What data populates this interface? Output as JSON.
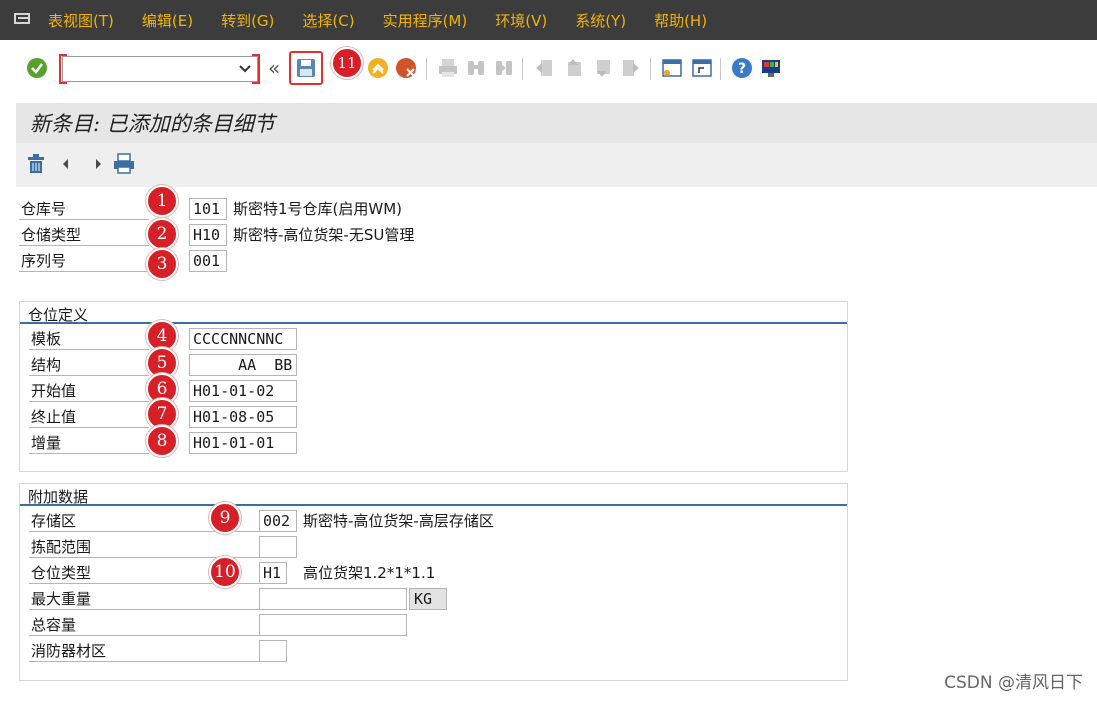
{
  "menubar": {
    "items": [
      "表视图(T)",
      "编辑(E)",
      "转到(G)",
      "选择(C)",
      "实用程序(M)",
      "环境(V)",
      "系统(Y)",
      "帮助(H)"
    ]
  },
  "toolbar": {
    "command_value": "",
    "history_glyph": "«"
  },
  "page_title": "新条目: 已添加的条目细节",
  "header_fields": {
    "warehouse": {
      "label": "仓库号",
      "value": "101",
      "desc": "斯密特1号仓库(启用WM)"
    },
    "storage_type": {
      "label": "仓储类型",
      "value": "H10",
      "desc": "斯密特-高位货架-无SU管理"
    },
    "sequence": {
      "label": "序列号",
      "value": "001"
    }
  },
  "bin_definition": {
    "title": "仓位定义",
    "template": {
      "label": "模板",
      "value": "CCCCNNCNNC"
    },
    "structure": {
      "label": "结构",
      "value": "     AA  BB"
    },
    "start": {
      "label": "开始值",
      "value": "H01-01-02"
    },
    "end": {
      "label": "终止值",
      "value": "H01-08-05"
    },
    "increment": {
      "label": "增量",
      "value": "H01-01-01"
    }
  },
  "additional": {
    "title": "附加数据",
    "storage_section": {
      "label": "存储区",
      "value": "002",
      "desc": "斯密特-高位货架-高层存储区"
    },
    "picking_area": {
      "label": "拣配范围",
      "value": ""
    },
    "bin_type": {
      "label": "仓位类型",
      "value": "H1",
      "desc": "高位货架1.2*1*1.1"
    },
    "max_weight": {
      "label": "最大重量",
      "value": "",
      "unit": "KG"
    },
    "total_capacity": {
      "label": "总容量",
      "value": ""
    },
    "fire_equipment": {
      "label": "消防器材区",
      "value": ""
    }
  },
  "badges": [
    "1",
    "2",
    "3",
    "4",
    "5",
    "6",
    "7",
    "8",
    "9",
    "10",
    "11"
  ],
  "watermark": "CSDN @清风日下",
  "colors": {
    "menu_bg": "#3c3c3c",
    "menu_text": "#f0b400",
    "badge": "#d71f27",
    "group_line": "#3a6ea5"
  }
}
